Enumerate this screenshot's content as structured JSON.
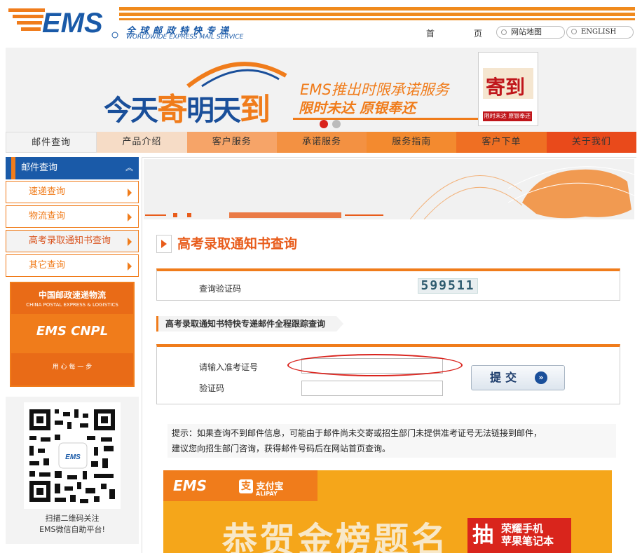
{
  "header": {
    "logo_text": "EMS",
    "slogan_cn": "全球邮政特快专递",
    "slogan_en": "WORLDWIDE EXPRESS MAIL SERVICE",
    "home_label_1": "首",
    "home_label_2": "页",
    "sitemap_label": "网站地图",
    "english_label": "ENGLISH"
  },
  "banner": {
    "headline_a": "今天",
    "headline_b": "寄",
    "headline_c": "明天",
    "headline_d": "到",
    "line1": "EMS推出时限承诺服务",
    "line2": "限时未达 原银奉还",
    "calendar_big": "寄到",
    "calendar_small": "限时未达 原银奉还"
  },
  "nav": {
    "items": [
      {
        "label": "邮件查询",
        "bg": "#f3f3f3"
      },
      {
        "label": "产品介绍",
        "bg": "#f6dcc6"
      },
      {
        "label": "客户服务",
        "bg": "#f6a468"
      },
      {
        "label": "承诺服务",
        "bg": "#f39142"
      },
      {
        "label": "服务指南",
        "bg": "#f38a2f"
      },
      {
        "label": "客户下单",
        "bg": "#ef6f23"
      },
      {
        "label": "关于我们",
        "bg": "#e94a1b"
      }
    ]
  },
  "sidebar": {
    "header": "邮件查询",
    "items": [
      {
        "label": "速递查询"
      },
      {
        "label": "物流查询"
      },
      {
        "label": "高考录取通知书查询"
      },
      {
        "label": "其它查询"
      }
    ],
    "logo_cn": "中国邮政速递物流",
    "logo_en": "CHINA POSTAL EXPRESS & LOGISTICS",
    "logo_mid": "EMS  CNPL",
    "logo_bottom": "用 心 每 一 步",
    "qr_caption_1": "扫描二维码关注",
    "qr_caption_2": "EMS微信自助平台!"
  },
  "main": {
    "title": "高考录取通知书查询",
    "captcha_label": "查询验证码",
    "captcha_value": "599511",
    "section_title": "高考录取通知书特快专递邮件全程跟踪查询",
    "exam_no_label": "请输入准考证号",
    "exam_no_value": "",
    "verify_label": "验证码",
    "verify_value": "",
    "submit_label": "提交",
    "tip_line1": "提示：如果查询不到邮件信息，可能由于邮件尚未交寄或招生部门未提供准考证号无法链接到邮件，",
    "tip_line2": "建议您向招生部门咨询，获得邮件号码后在网站首页查询。"
  },
  "promo": {
    "ems": "EMS",
    "alipay_cn": "支付宝",
    "alipay_en": "ALIPAY",
    "big_text": "恭贺金榜题名",
    "chou": "抽",
    "prize_1": "荣耀手机",
    "prize_2": "苹果笔记本"
  },
  "colors": {
    "brand_orange": "#f07c1b",
    "brand_blue": "#1a5aa8",
    "highlight_red": "#d9231d"
  }
}
